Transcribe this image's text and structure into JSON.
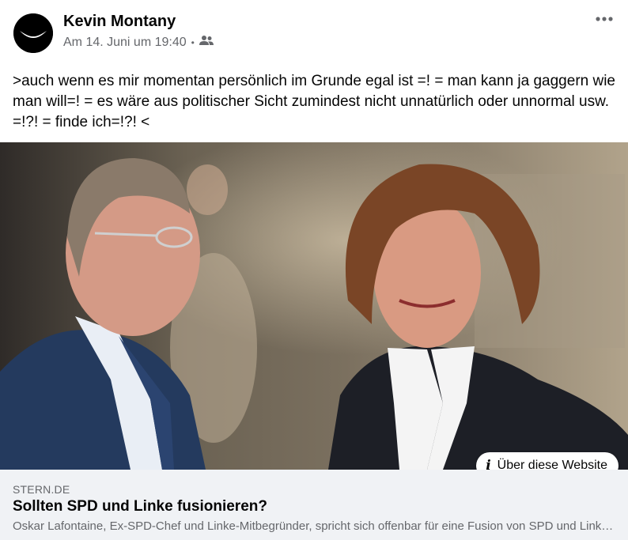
{
  "post": {
    "author": "Kevin Montany",
    "timestamp": "Am 14. Juni um 19:40",
    "separator": "•",
    "audience_icon": "friends-icon",
    "more_icon": "more-options-icon",
    "text": ">auch wenn es mir momentan persönlich im Grunde egal ist =! = man kann ja gaggern wie man will=! = es wäre aus politischer Sicht zumindest nicht unnatürlich oder unnormal usw. =!?! = finde ich=!?! <"
  },
  "link": {
    "info_label": "Über diese Website",
    "info_icon": "info-icon",
    "domain": "STERN.DE",
    "headline": "Sollten SPD und Linke fusionieren?",
    "description": "Oskar Lafontaine, Ex-SPD-Chef und Linke-Mitbegründer, spricht sich offenbar für eine Fusion von SPD und Linke aus"
  },
  "colors": {
    "text_primary": "#050505",
    "text_secondary": "#65676b",
    "card_background": "#f0f2f5"
  }
}
